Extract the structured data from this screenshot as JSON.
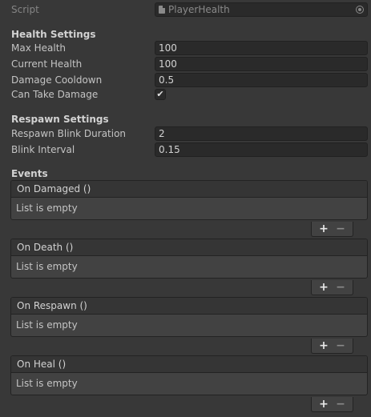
{
  "script_row": {
    "label": "Script",
    "value": "PlayerHealth",
    "icon": "script-file-icon"
  },
  "health_settings": {
    "header": "Health Settings",
    "fields": [
      {
        "label": "Max Health",
        "value": "100"
      },
      {
        "label": "Current Health",
        "value": "100"
      },
      {
        "label": "Damage Cooldown",
        "value": "0.5"
      }
    ],
    "can_take_damage": {
      "label": "Can Take Damage",
      "checked": true,
      "check_glyph": "✔"
    }
  },
  "respawn_settings": {
    "header": "Respawn Settings",
    "fields": [
      {
        "label": "Respawn Blink Duration",
        "value": "2"
      },
      {
        "label": "Blink Interval",
        "value": "0.15"
      }
    ]
  },
  "events": {
    "header": "Events",
    "items": [
      {
        "title": "On Damaged ()",
        "body": "List is empty"
      },
      {
        "title": "On Death ()",
        "body": "List is empty"
      },
      {
        "title": "On Respawn ()",
        "body": "List is empty"
      },
      {
        "title": "On Heal ()",
        "body": "List is empty"
      }
    ],
    "add_glyph": "+",
    "remove_glyph": "−"
  }
}
